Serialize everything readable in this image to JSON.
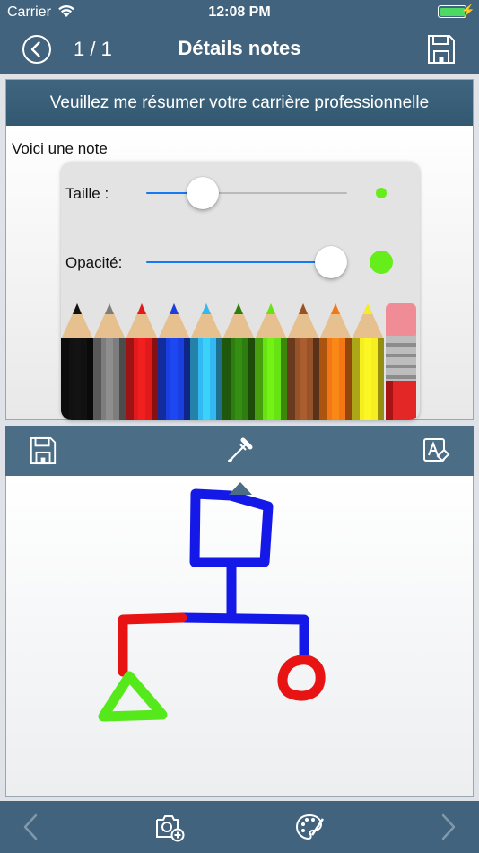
{
  "status": {
    "carrier": "Carrier",
    "time": "12:08 PM",
    "battery_level": 1.0
  },
  "nav": {
    "counter": "1 / 1",
    "title": "Détails notes"
  },
  "question": {
    "header": "Veuillez me résumer votre carrière professionnelle",
    "note": "Voici une note"
  },
  "brush": {
    "size_label": "Taille :",
    "size_value": 0.24,
    "opacity_label": "Opacité:",
    "opacity_value": 1.0,
    "color": "#66ee1b"
  },
  "palette": {
    "colors": [
      "#111111",
      "#7d7d7d",
      "#e11b1b",
      "#1a3fe0",
      "#33b9f2",
      "#2e7d10",
      "#66e312",
      "#96532a",
      "#f37815",
      "#f6ee20"
    ],
    "tools": [
      "eraser-icon"
    ]
  },
  "toolbar": {
    "icons": [
      "save-icon",
      "eyedropper-icon",
      "erase-text-icon"
    ]
  },
  "bottom": {
    "icons": [
      "chevron-left-icon",
      "add-photo-icon",
      "palette-icon",
      "chevron-right-icon"
    ]
  }
}
